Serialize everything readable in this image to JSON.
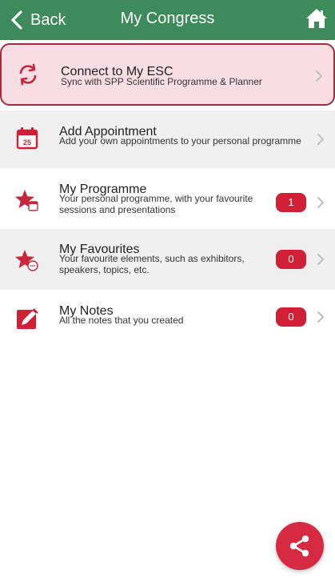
{
  "header": {
    "back_label": "Back",
    "title": "My Congress",
    "bar_color": "#3d8a5a"
  },
  "items": [
    {
      "title": "Connect to My ESC",
      "subtitle": "Sync with SPP Scientific Programme & Planner",
      "icon": "sync-icon",
      "badge": null
    },
    {
      "title": "Add Appointment",
      "subtitle": "Add your own appointments to your personal programme",
      "icon": "calendar-icon",
      "calendar_day": "25",
      "badge": null
    },
    {
      "title": "My Programme",
      "subtitle": "Your personal programme, with your favourite sessions and presentations",
      "icon": "star-calendar-icon",
      "badge": "1"
    },
    {
      "title": "My Favourites",
      "subtitle": "Your favourite elements, such as exhibitors, speakers, topics, etc.",
      "icon": "star-chat-icon",
      "badge": "0"
    },
    {
      "title": "My Notes",
      "subtitle": "All the notes that you created",
      "icon": "note-pencil-icon",
      "badge": "0"
    }
  ],
  "colors": {
    "accent_red": "#d11f35",
    "highlight_bg": "#f8dde3",
    "highlight_border": "#a32b3f"
  },
  "fab": {
    "icon": "share-icon"
  }
}
